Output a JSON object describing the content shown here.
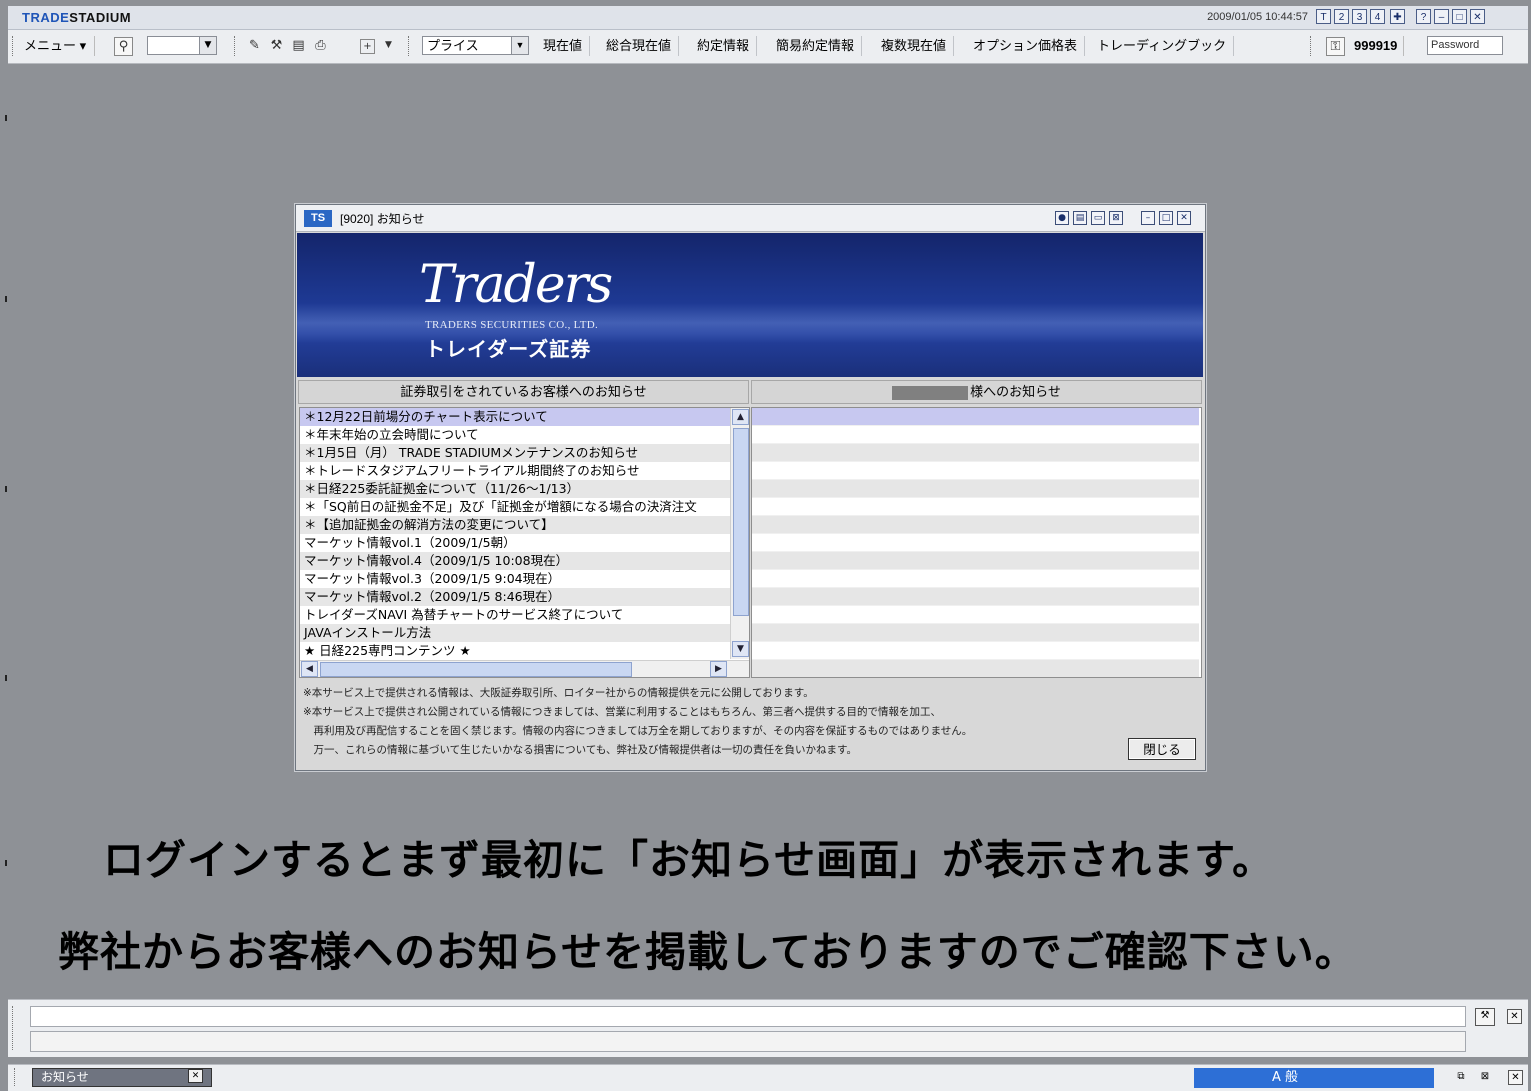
{
  "app": {
    "brand_part1": "TRADE",
    "brand_part2": "STADIUM",
    "datetime": "2009/01/05 10:44:57",
    "window_buttons": [
      "T",
      "2",
      "3",
      "4"
    ]
  },
  "toolbar": {
    "menu_label": "メニュー ▾",
    "select_value": "プライス",
    "items": [
      "現在値",
      "総合現在値",
      "約定情報",
      "簡易約定情報",
      "複数現在値",
      "オプション価格表",
      "トレーディングブック"
    ],
    "account": "999919",
    "password_placeholder": "Password"
  },
  "dialog": {
    "logo": "TS",
    "caption": "[9020] お知らせ",
    "banner": {
      "script": "Traders",
      "company_en": "TRADERS SECURITIES CO., LTD.",
      "company_jp": "トレイダーズ証券"
    },
    "left_header": "証券取引をされているお客様へのお知らせ",
    "right_header_suffix": "様へのお知らせ",
    "notices": [
      "＊12月22日前場分のチャート表示について",
      "＊年末年始の立会時間について",
      "＊1月5日（月） TRADE STADIUMメンテナンスのお知らせ",
      "＊トレードスタジアムフリートライアル期間終了のお知らせ",
      "＊日経225委託証拠金について（11/26〜1/13）",
      "＊「SQ前日の証拠金不足」及び「証拠金が増額になる場合の決済注文",
      "＊【追加証拠金の解消方法の変更について】",
      "マーケット情報vol.1（2009/1/5朝）",
      "マーケット情報vol.4（2009/1/5 10:08現在）",
      "マーケット情報vol.3（2009/1/5 9:04現在）",
      "マーケット情報vol.2（2009/1/5 8:46現在）",
      "トレイダーズNAVI 為替チャートのサービス終了について",
      "JAVAインストール方法",
      "★ 日経225専門コンテンツ ★"
    ],
    "footer": [
      "※本サービス上で提供される情報は、大阪証券取引所、ロイター社からの情報提供を元に公開しております。",
      "※本サービス上で提供され公開されている情報につきましては、営業に利用することはもちろん、第三者へ提供する目的で情報を加工、",
      "　再利用及び再配信することを固く禁じます。情報の内容につきましては万全を期しておりますが、その内容を保証するものではありません。",
      "　万一、これらの情報に基づいて生じたいかなる損害についても、弊社及び情報提供者は一切の責任を負いかねます。"
    ],
    "close_label": "閉じる"
  },
  "captions": {
    "line1": "ログインするとまず最初に「お知らせ画面」が表示されます。",
    "line2": "弊社からお客様へのお知らせを掲載しておりますのでご確認下さい。"
  },
  "taskbar": {
    "tab_label": "お知らせ",
    "ime_text": "A 般"
  },
  "colors": {
    "desktop": "#8e9196",
    "banner": "#1d3891",
    "selected_row": "#c7c8f0",
    "brand_blue": "#1f55b8"
  }
}
